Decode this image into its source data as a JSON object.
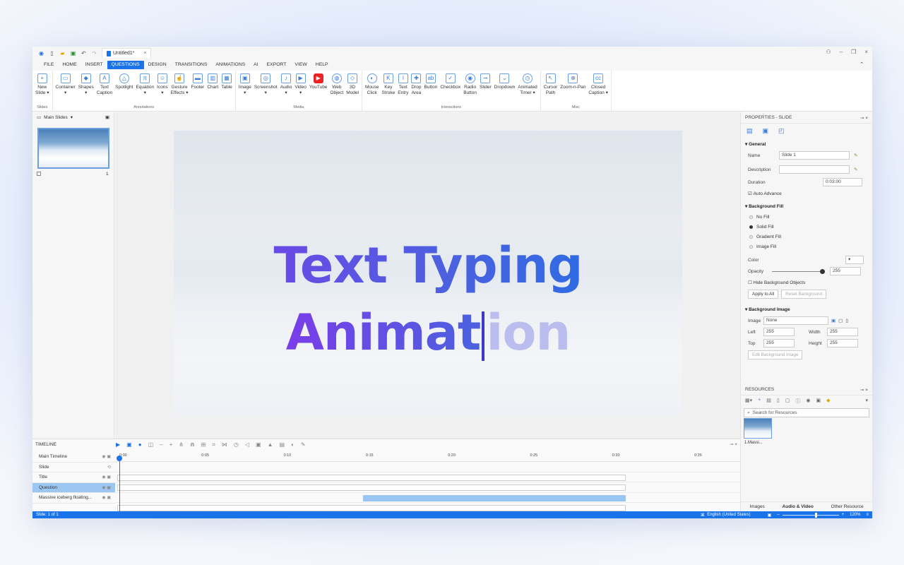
{
  "window": {
    "tab_title": "Untitled1*",
    "colors": {
      "accent": "#1a73e8",
      "title_gradient_start": "#7a3de8",
      "title_gradient_end": "#1a73e8"
    }
  },
  "menu": [
    "FILE",
    "HOME",
    "INSERT",
    "QUESTIONS",
    "DESIGN",
    "TRANSITIONS",
    "ANIMATIONS",
    "AI",
    "EXPORT",
    "VIEW",
    "HELP"
  ],
  "menu_active": "QUESTIONS",
  "ribbon": {
    "groups": [
      {
        "label": "Slides",
        "items": [
          {
            "t1": "New",
            "t2": "Slide ▾",
            "icon": "+"
          }
        ]
      },
      {
        "label": "Annotations",
        "items": [
          {
            "t1": "Container",
            "t2": "▾",
            "icon": "▭"
          },
          {
            "t1": "Shapes",
            "t2": "▾",
            "icon": "◆"
          },
          {
            "t1": "Text",
            "t2": "Caption",
            "icon": "A"
          },
          {
            "t1": "Spotlight",
            "t2": "",
            "icon": "△"
          },
          {
            "t1": "Equation",
            "t2": "▾",
            "icon": "π"
          },
          {
            "t1": "Icons",
            "t2": "▾",
            "icon": "☺"
          },
          {
            "t1": "Gesture",
            "t2": "Effects ▾",
            "icon": "☝"
          },
          {
            "t1": "Footer",
            "t2": "",
            "icon": "▬"
          },
          {
            "t1": "Chart",
            "t2": "",
            "icon": "▥"
          },
          {
            "t1": "Table",
            "t2": "",
            "icon": "▦"
          }
        ]
      },
      {
        "label": "Media",
        "items": [
          {
            "t1": "Image",
            "t2": "▾",
            "icon": "▣"
          },
          {
            "t1": "Screenshot",
            "t2": "▾",
            "icon": "◎"
          },
          {
            "t1": "Audio",
            "t2": "▾",
            "icon": "♪"
          },
          {
            "t1": "Video",
            "t2": "▾",
            "icon": "▶"
          },
          {
            "t1": "YouTube",
            "t2": "",
            "icon": "▶"
          },
          {
            "t1": "Web",
            "t2": "Object",
            "icon": "◍"
          },
          {
            "t1": "3D",
            "t2": "Model",
            "icon": "◇"
          }
        ]
      },
      {
        "label": "Interactions",
        "items": [
          {
            "t1": "Mouse",
            "t2": "Click",
            "icon": "◐"
          },
          {
            "t1": "Key",
            "t2": "Stroke",
            "icon": "K"
          },
          {
            "t1": "Text",
            "t2": "Entry",
            "icon": "I"
          },
          {
            "t1": "Drop",
            "t2": "Area",
            "icon": "✚"
          },
          {
            "t1": "Button",
            "t2": "",
            "icon": "ab"
          },
          {
            "t1": "Checkbox",
            "t2": "",
            "icon": "✓"
          },
          {
            "t1": "Radio",
            "t2": "Button",
            "icon": "◉"
          },
          {
            "t1": "Slider",
            "t2": "",
            "icon": "⊸"
          },
          {
            "t1": "Dropdown",
            "t2": "",
            "icon": "⌄"
          },
          {
            "t1": "Animated",
            "t2": "Timer ▾",
            "icon": "◷"
          }
        ]
      },
      {
        "label": "Misc",
        "items": [
          {
            "t1": "Cursor",
            "t2": "Path",
            "icon": "↖"
          },
          {
            "t1": "Zoom-n-Pan",
            "t2": "",
            "icon": "⊕"
          },
          {
            "t1": "Closed",
            "t2": "Caption ▾",
            "icon": "cc"
          }
        ]
      }
    ]
  },
  "slides_panel": {
    "title": "Main Slides",
    "slide_number": "1"
  },
  "slide": {
    "line1": "Text Typing",
    "line2_typed": "Animat",
    "line2_rest": "ion"
  },
  "properties": {
    "title": "PROPERTIES - SLIDE",
    "general": "General",
    "name_label": "Name",
    "name_value": "Slide 1",
    "desc_label": "Description",
    "desc_value": "",
    "duration_label": "Duration",
    "duration_value": "0:03:00",
    "auto_advance": "Auto Advance",
    "bg_fill": "Background Fill",
    "fill_options": [
      "No Fill",
      "Solid Fill",
      "Gradient Fill",
      "Image Fill"
    ],
    "fill_selected": "Solid Fill",
    "color_label": "Color",
    "opacity_label": "Opacity",
    "opacity_value": "255",
    "hide_bg": "Hide Background Objects",
    "apply_all": "Apply to All",
    "reset_bg": "Reset Background",
    "bg_image": "Background Image",
    "image_label": "Image",
    "image_value": "None",
    "left_label": "Left",
    "left_value": "255",
    "width_label": "Width",
    "width_value": "255",
    "top_label": "Top",
    "top_value": "255",
    "height_label": "Height",
    "height_value": "255",
    "edit_bg_image": "Edit Background Image"
  },
  "resources": {
    "title": "RESOURCES",
    "search_placeholder": "Search for Resources",
    "item_label": "1.Massi...",
    "tabs": [
      "Images",
      "Audio & Video",
      "Other Resource"
    ]
  },
  "timeline": {
    "title": "TIMELINE",
    "rows": [
      "Main Timeline",
      "Slide",
      "Title",
      "Question",
      "Massive iceberg floating..."
    ],
    "selected_row": "Question",
    "ticks": [
      "0:00",
      "0:05",
      "0:10",
      "0:15",
      "0:20",
      "0:25",
      "0:30",
      "0:35"
    ]
  },
  "status": {
    "slide": "Slide: 1 of 1",
    "language": "English (United States)",
    "zoom": "120%"
  }
}
